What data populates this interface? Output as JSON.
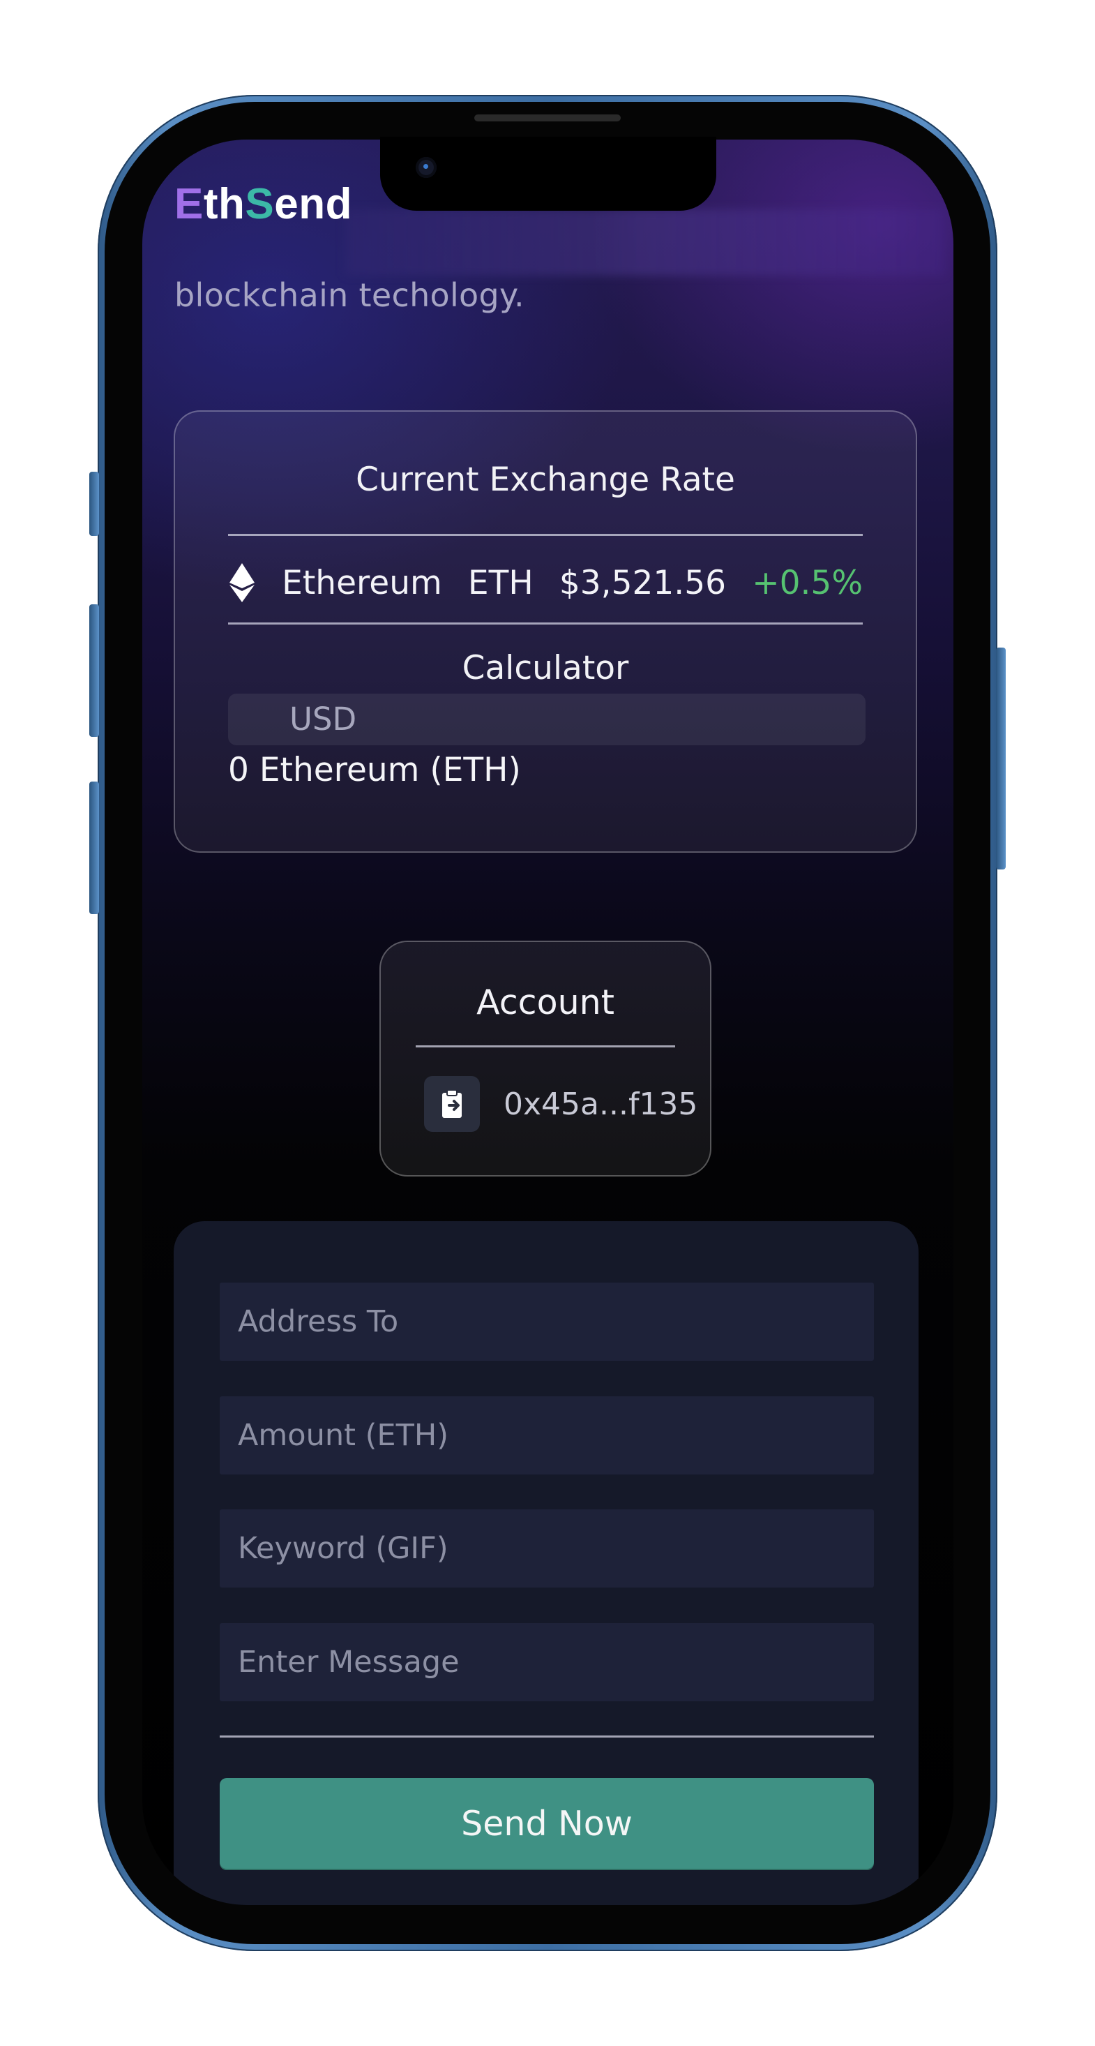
{
  "app": {
    "logo_prefix": "E",
    "logo_mid": "th",
    "logo_s": "S",
    "logo_suffix": "end",
    "tagline": "blockchain techology."
  },
  "exchange": {
    "title": "Current Exchange Rate",
    "coin_name": "Ethereum",
    "coin_symbol": "ETH",
    "price": "$3,521.56",
    "change": "+0.5%",
    "change_color": "#56c271"
  },
  "calculator": {
    "title": "Calculator",
    "input_placeholder": "USD",
    "result": "0 Ethereum (ETH)"
  },
  "account": {
    "title": "Account",
    "address": "0x45a...f135"
  },
  "send_form": {
    "address_placeholder": "Address To",
    "amount_placeholder": "Amount (ETH)",
    "keyword_placeholder": "Keyword (GIF)",
    "message_placeholder": "Enter Message",
    "submit_label": "Send Now",
    "accent": "#3f9184"
  }
}
